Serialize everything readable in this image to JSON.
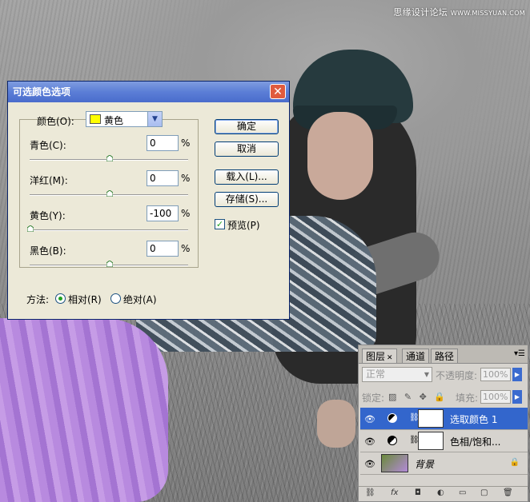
{
  "watermark": {
    "text": "思缘设计论坛",
    "url": "WWW.MISSYUAN.COM"
  },
  "dialog": {
    "title": "可选颜色选项",
    "color_label": "颜色(O):",
    "color_value": "黄色",
    "color_swatch": "#ffff00",
    "rows": [
      {
        "label": "青色(C):",
        "value": "0",
        "unit": "%",
        "slider": 0
      },
      {
        "label": "洋红(M):",
        "value": "0",
        "unit": "%",
        "slider": 0
      },
      {
        "label": "黄色(Y):",
        "value": "-100",
        "unit": "%",
        "slider": -100
      },
      {
        "label": "黑色(B):",
        "value": "0",
        "unit": "%",
        "slider": 0
      }
    ],
    "buttons": {
      "ok": "确定",
      "cancel": "取消",
      "load": "载入(L)...",
      "save": "存储(S)..."
    },
    "preview_label": "预览(P)",
    "preview_checked": true,
    "method_label": "方法:",
    "method_relative": "相对(R)",
    "method_absolute": "绝对(A)",
    "method_selected": "relative",
    "close_icon": "close-icon"
  },
  "layers_panel": {
    "tabs": [
      "图层",
      "通道",
      "路径"
    ],
    "active_tab": "图层",
    "blend_mode": "正常",
    "opacity_label": "不透明度:",
    "opacity_value": "100%",
    "lock_label": "锁定:",
    "fill_label": "填充:",
    "fill_value": "100%",
    "layers": [
      {
        "name": "选取颜色 1",
        "selected": true
      },
      {
        "name": "色相/饱和...",
        "selected": false
      },
      {
        "name": "背景",
        "selected": false
      }
    ],
    "accent": "#3366cc"
  }
}
